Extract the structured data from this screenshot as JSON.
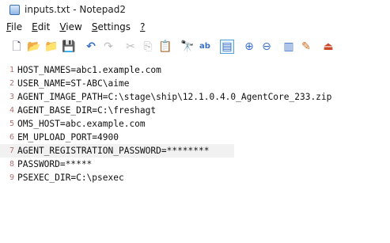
{
  "window": {
    "title": "inputs.txt - Notepad2"
  },
  "menu": [
    {
      "pre": "",
      "ul": "F",
      "post": "ile"
    },
    {
      "pre": "",
      "ul": "E",
      "post": "dit"
    },
    {
      "pre": "",
      "ul": "V",
      "post": "iew"
    },
    {
      "pre": "",
      "ul": "S",
      "post": "ettings"
    },
    {
      "pre": "",
      "ul": "?",
      "post": ""
    }
  ],
  "toolbar": {
    "new": "🗋",
    "open": "📂",
    "browse": "📁",
    "save": "💾",
    "undo": "↶",
    "redo": "↷",
    "cut": "✂",
    "copy": "⎘",
    "paste": "📋",
    "find": "🔭",
    "replace": "ab",
    "wordwrap": "▤",
    "zoom_in": "⊕",
    "zoom_out": "⊖",
    "view": "▥",
    "scheme": "✎",
    "exit": "⏏"
  },
  "lines": [
    "HOST_NAMES=abc1.example.com",
    "USER_NAME=ST-ABC\\aime",
    "AGENT_IMAGE_PATH=C:\\stage\\ship\\12.1.0.4.0_AgentCore_233.zip",
    "AGENT_BASE_DIR=C:\\freshagt",
    "OMS_HOST=abc.example.com",
    "EM_UPLOAD_PORT=4900",
    "AGENT_REGISTRATION_PASSWORD=********",
    "PASSWORD=*****",
    "PSEXEC_DIR=C:\\psexec"
  ],
  "line_numbers": [
    "1",
    "2",
    "3",
    "4",
    "5",
    "6",
    "7",
    "8",
    "9"
  ]
}
